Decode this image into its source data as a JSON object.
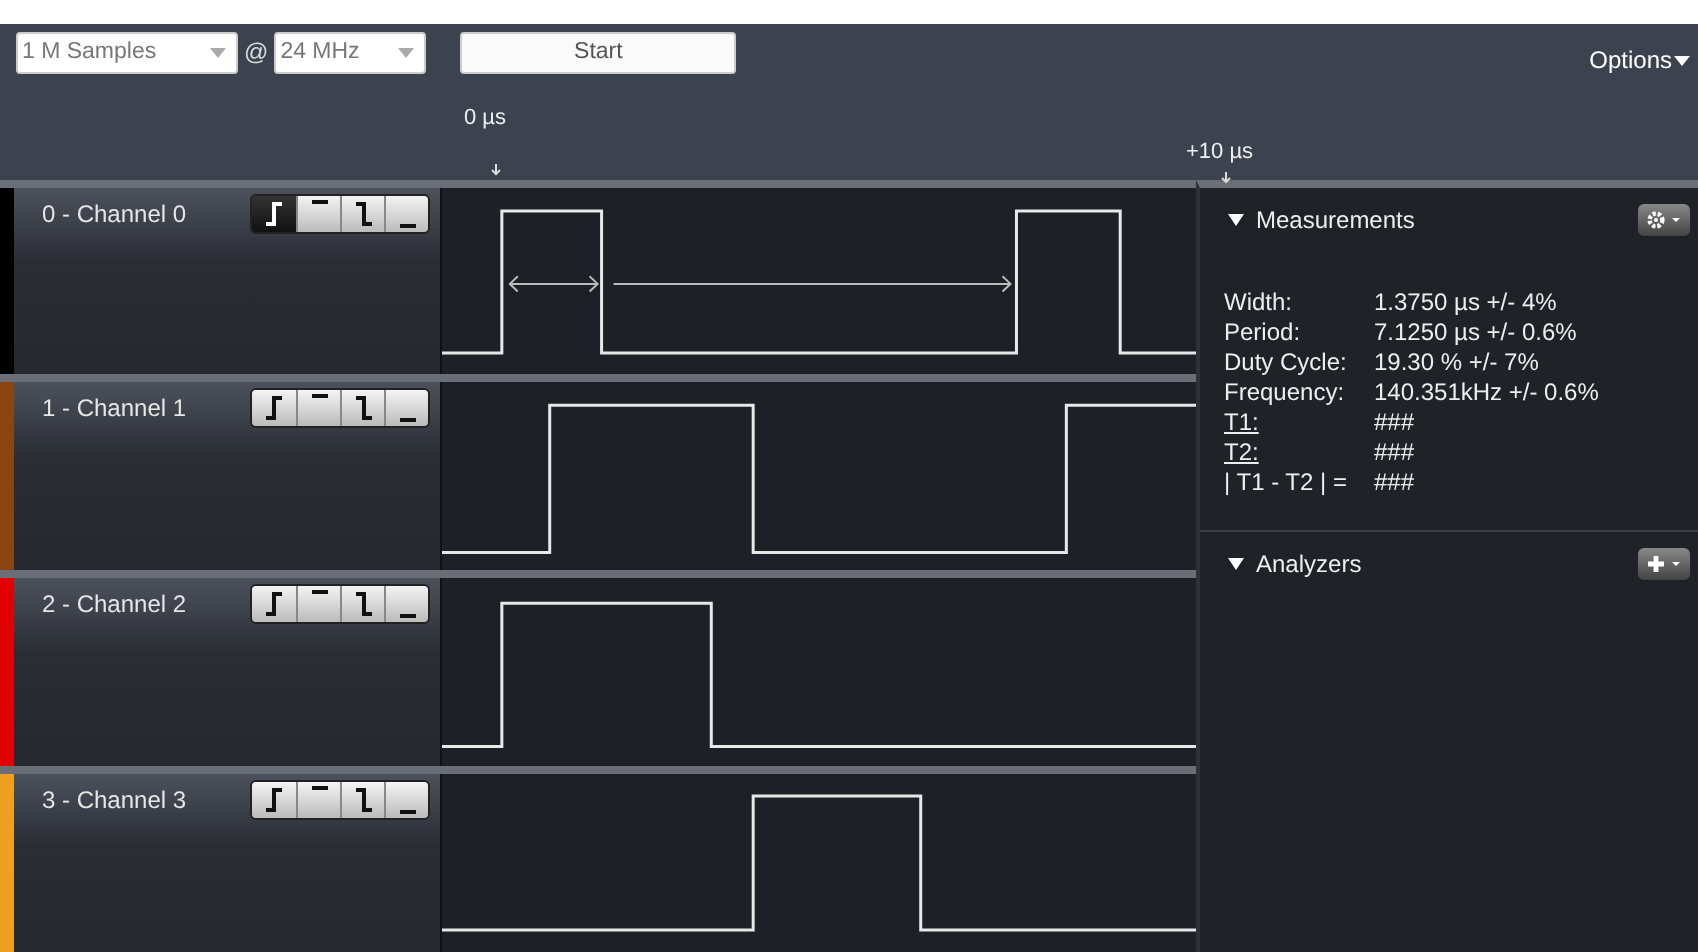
{
  "toolbar": {
    "sample_count": "1 M Samples",
    "at_sign": "@",
    "sample_rate": "24 MHz",
    "start_button": "Start",
    "options_menu": "Options"
  },
  "timeline": {
    "marks": [
      "0 µs",
      "+10 µs"
    ]
  },
  "channels": [
    {
      "name": "0 - Channel 0",
      "color": "#000000",
      "markers": true,
      "triggers": [
        {
          "kind": "rising",
          "selected": true
        },
        {
          "kind": "high",
          "selected": false
        },
        {
          "kind": "falling",
          "selected": false
        },
        {
          "kind": "low",
          "selected": false
        }
      ]
    },
    {
      "name": "1 - Channel 1",
      "color": "#8a4510",
      "markers": false,
      "triggers": [
        {
          "kind": "rising",
          "selected": false
        },
        {
          "kind": "high",
          "selected": false
        },
        {
          "kind": "falling",
          "selected": false
        },
        {
          "kind": "low",
          "selected": false
        }
      ]
    },
    {
      "name": "2 - Channel 2",
      "color": "#e00000",
      "markers": false,
      "triggers": [
        {
          "kind": "rising",
          "selected": false
        },
        {
          "kind": "high",
          "selected": false
        },
        {
          "kind": "falling",
          "selected": false
        },
        {
          "kind": "low",
          "selected": false
        }
      ]
    },
    {
      "name": "3 - Channel 3",
      "color": "#f0a020",
      "markers": false,
      "triggers": [
        {
          "kind": "rising",
          "selected": false
        },
        {
          "kind": "high",
          "selected": false
        },
        {
          "kind": "falling",
          "selected": false
        },
        {
          "kind": "low",
          "selected": false
        }
      ]
    }
  ],
  "measurements": {
    "title": "Measurements",
    "rows": [
      {
        "label": "Width:",
        "value": "1.3750 µs +/- 4%",
        "kind": "plain"
      },
      {
        "label": "Period:",
        "value": "7.1250 µs +/- 0.6%",
        "kind": "plain"
      },
      {
        "label": "Duty Cycle:",
        "value": "19.30 % +/- 7%",
        "kind": "plain"
      },
      {
        "label": "Frequency:",
        "value": "140.351kHz +/- 0.6%",
        "kind": "plain"
      },
      {
        "label": "T1:",
        "value": "###",
        "kind": "link"
      },
      {
        "label": "T2:",
        "value": "###",
        "kind": "link"
      },
      {
        "label": "| T1 - T2 | =",
        "value": "###",
        "kind": "plain"
      }
    ]
  },
  "analyzers": {
    "title": "Analyzers"
  }
}
